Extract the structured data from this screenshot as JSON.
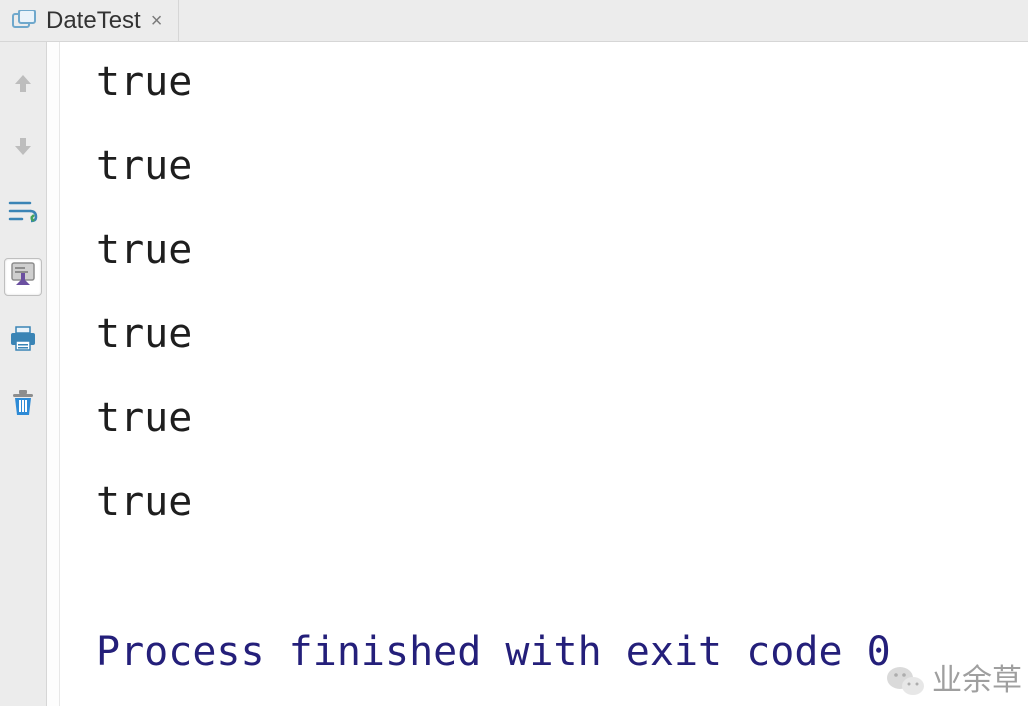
{
  "tab": {
    "title": "DateTest"
  },
  "toolbar": {
    "items": [
      {
        "name": "scroll-up-icon",
        "interactable": "true"
      },
      {
        "name": "scroll-down-icon",
        "interactable": "true"
      },
      {
        "name": "soft-wrap-icon",
        "interactable": "true"
      },
      {
        "name": "scroll-to-end-icon",
        "interactable": "true",
        "selected": true
      },
      {
        "name": "print-icon",
        "interactable": "true"
      },
      {
        "name": "trash-icon",
        "interactable": "true"
      }
    ]
  },
  "console": {
    "lines": [
      "true",
      "true",
      "true",
      "true",
      "true",
      "true"
    ],
    "exit_message": "Process finished with exit code 0"
  },
  "watermark": {
    "text": "业余草"
  }
}
